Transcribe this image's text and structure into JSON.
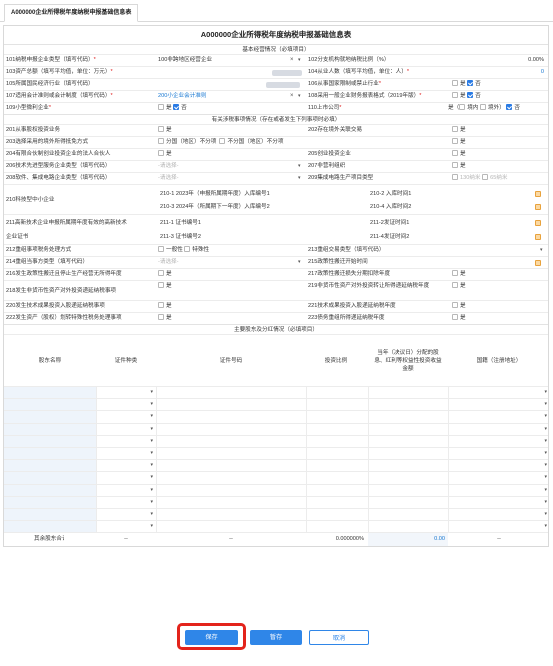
{
  "tab": {
    "label": "A000000企业所得税年度纳税申报基础信息表"
  },
  "form": {
    "title": "A000000企业所得税年度纳税申报基础信息表",
    "sections": {
      "basic": "基本经营情况（必填项目）",
      "related": "有关涉税事项情况（存在或者发生下列事项时必填）",
      "shareholders": "主要股东及分红情况（必填项目）"
    },
    "basic_rows": [
      {
        "l_label": "101纳税申报企业类型（填写代码）",
        "l_req": "*",
        "l_value": "100非跨地区经营企业",
        "r_label": "102分支机构就地纳税比例（%）",
        "r_value": "0.00%"
      },
      {
        "l_label": "103资产总额（填写平均值，单位：万元）",
        "l_req": "*",
        "l_value": "",
        "r_label": "104从业人数（填写平均值，单位：人）",
        "r_req": "*",
        "r_value": "0"
      },
      {
        "l_label": "105所属国民经济行业（填写代码）",
        "l_value": "",
        "r_label": "106从事国家限制或禁止行业",
        "r_req": "*",
        "r_opt1": "是",
        "r_opt2": "否"
      },
      {
        "l_label": "107适用会计准则或会计制度（填写代码）",
        "l_req": "*",
        "l_value": "200小企业会计准则",
        "r_label": "108采用一般企业财务报表格式（2019年版）",
        "r_req": "*",
        "r_opt1": "是",
        "r_opt2": "否"
      },
      {
        "l_label": "109小型微利企业",
        "l_req": "*",
        "l_opt1": "是",
        "l_opt2": "否",
        "r_label": "110上市公司",
        "r_req": "*",
        "r_opt1": "是（",
        "r_opt2": "境内",
        "r_opt3": "境外）",
        "r_opt4": "否"
      }
    ],
    "related_rows": [
      {
        "l_label": "201从事股权投资业务",
        "l_opt": "是",
        "r_label": "202存在境外关联交易",
        "r_opt": "是"
      },
      {
        "l_label": "203选择采用的境外所得抵免方式",
        "opts": [
          "分国（地区）不分项",
          "不分国（地区）不分项"
        ],
        "r_opt": "是"
      },
      {
        "l_label": "204有限合伙制创业投资企业的法人合伙人",
        "l_opt": "是",
        "r_label": "205创业投资企业",
        "r_opt": "是"
      },
      {
        "l_label": "206技术先进型服务企业类型（填写代码）",
        "l_placeholder": "-请选择-",
        "r_label": "207非营利组织",
        "r_opt": "是"
      },
      {
        "l_label": "208软件、集成电路企业类型（填写代码）",
        "l_placeholder": "-请选择-",
        "r_label": "209集成电路生产项目类型",
        "r_opts": [
          "130纳米",
          "65纳米"
        ]
      }
    ],
    "r210": {
      "label": "210科技型中小企业",
      "a1": "210-1   2023年（申报所属期年度）入库编号1",
      "a2": "210-2 入库时间1",
      "b1": "210-3   2024年（所属期下一年度）入库编号2",
      "b2": "210-4 入库时间2"
    },
    "r211": {
      "label1": "211高新技术企业申报所属期年度有效的高新技术",
      "label2": "企业证书",
      "a1": "211-1 证书编号1",
      "a2": "211-2发证时间1",
      "b1": "211-3 证书编号2",
      "b2": "211-4发证时间2"
    },
    "tail_rows": [
      {
        "l_label": "212重组事项税务处理方式",
        "opts": [
          "一般性",
          "特殊性"
        ],
        "r_label": "213重组交易类型（填写代码）"
      },
      {
        "l_label": "214重组当事方类型（填写代码）",
        "l_placeholder": "-请选择-",
        "r_label": "215政策性搬迁开始时间"
      },
      {
        "l_label": "216发生政策性搬迁且停止生产经营无所得年度",
        "l_opt": "是",
        "r_label": "217政策性搬迁损失分期扣除年度",
        "r_opt": "是"
      },
      {
        "l_label": "218发生非货币性资产对外投资递延纳税事项",
        "l_opt": "是",
        "r_label": "219非货币性资产对外投资转让所得递延纳税年度",
        "r_opt": "是"
      },
      {
        "l_label": "220发生技术成果投资入股递延纳税事项",
        "l_opt": "是",
        "r_label": "221技术成果投资入股递延纳税年度",
        "r_opt": "是"
      },
      {
        "l_label": "222发生资产（股权）划转特殊性税务处理事项",
        "l_opt": "是",
        "r_label": "223债务重组所得递延纳税年度",
        "r_opt": "是"
      }
    ],
    "shareholder_table": {
      "headers": [
        "股东名称",
        "证件种类",
        "证件号码",
        "投资比例",
        "当年（决议日）分配的股息、红利等权益性投资收益金额",
        "国籍（注册地址）"
      ],
      "total_label": "其余股东合计",
      "total_values": [
        "--",
        "--",
        "0.000000%",
        "0.00",
        "--"
      ]
    }
  },
  "buttons": {
    "save": "保存",
    "temp_save": "暂存",
    "cancel": "取消"
  },
  "colors": {
    "accent": "#2f86e8",
    "highlight": "#e3231b",
    "required": "#e02020"
  }
}
